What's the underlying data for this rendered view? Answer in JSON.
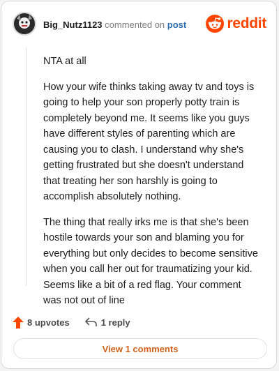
{
  "header": {
    "username": "Big_Nutz1123",
    "action_text": "commented on",
    "post_link": "post",
    "logo_text": "reddit",
    "logo_icon": "reddit-snoo-icon",
    "brand_color": "#ff4500"
  },
  "comment": {
    "paragraphs": [
      "NTA at all",
      "How your wife thinks taking away tv and toys is going to help your son properly potty train is completely beyond me. It seems like you guys have different styles of parenting which are causing you to clash. I understand why she's getting frustrated but she doesn't understand that treating her son harshly is going to accomplish absolutely nothing.",
      "The thing that really irks me is that she's been hostile towards your son and blaming you for everything but only decides to become sensitive when you call her out for traumatizing your kid. Seems like a bit of a red flag. Your comment was not out of line"
    ]
  },
  "footer": {
    "upvotes_label": "8 upvotes",
    "reply_label": "1 reply",
    "view_button": "View 1 comments",
    "upvote_color": "#ff4500",
    "view_color": "#d4621c"
  }
}
